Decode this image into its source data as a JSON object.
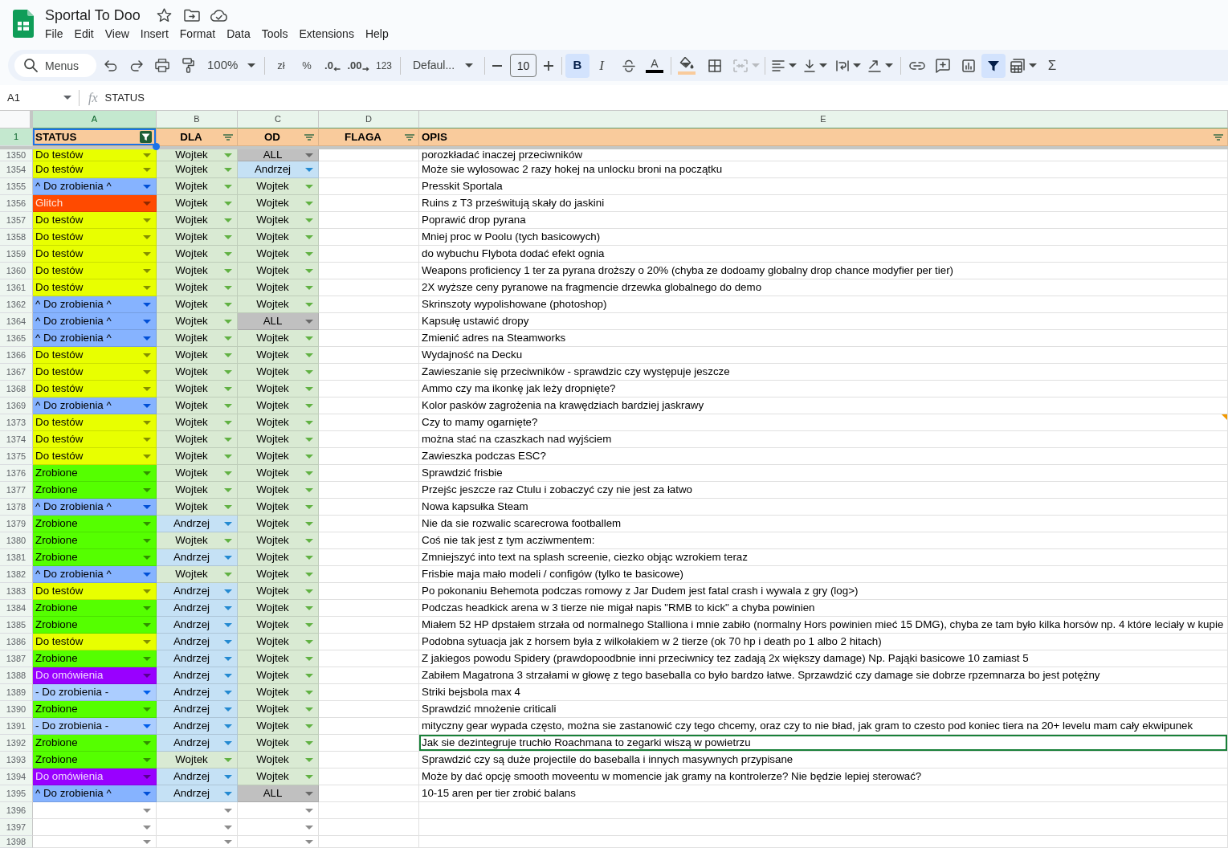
{
  "document": {
    "title": "Sportal To Doo",
    "menu": [
      "File",
      "Edit",
      "View",
      "Insert",
      "Format",
      "Data",
      "Tools",
      "Extensions",
      "Help"
    ]
  },
  "toolbar": {
    "search": {
      "placeholder": "Menus"
    },
    "zoom": "100%",
    "currency": "zł",
    "percent": "%",
    "decimal_decrease": ".0",
    "decimal_increase": ".00",
    "number_format": "123",
    "font": "Defaul...",
    "font_size": "10",
    "bold": {
      "label": "B",
      "selected": true
    },
    "italic": {
      "label": "I",
      "selected": false
    },
    "text_color": {
      "label": "A",
      "color": "#000000"
    },
    "fill_color": {
      "color": "#f9cb9c"
    },
    "merge": {
      "disabled": true
    },
    "filter": {
      "selected": true
    },
    "functions": "Σ"
  },
  "formula_bar": {
    "name_box": "A1",
    "fx": "fx",
    "content": "STATUS"
  },
  "sheet": {
    "column_letters": [
      {
        "label": "A",
        "selected": true
      },
      {
        "label": "B",
        "selected": false
      },
      {
        "label": "C",
        "selected": false
      },
      {
        "label": "D",
        "selected": false
      },
      {
        "label": "E",
        "selected": false
      }
    ],
    "header_row": {
      "number": "1",
      "cells": [
        {
          "text": "STATUS",
          "selected": true,
          "filter_active": true
        },
        {
          "text": "DLA",
          "selected": false,
          "filter_active": false
        },
        {
          "text": "OD",
          "selected": false,
          "filter_active": false
        },
        {
          "text": "FLAGA",
          "selected": false,
          "filter_active": false
        },
        {
          "text": "OPIS",
          "selected": false,
          "filter_active": false
        }
      ]
    },
    "rows": [
      {
        "number": "1350",
        "status": {
          "text": "Do testów",
          "color": "#e8ff00"
        },
        "dla": {
          "text": "Wojtek",
          "color": "#d9ead3"
        },
        "od": {
          "text": "ALL",
          "color": "#c0c0c0"
        },
        "opis": "porozkładać inaczej przeciwników",
        "note": false,
        "outlined": false
      },
      {
        "number": "1354",
        "status": {
          "text": "Do testów",
          "color": "#e8ff00"
        },
        "dla": {
          "text": "Wojtek",
          "color": "#d9ead3"
        },
        "od": {
          "text": "Andrzej",
          "color": "#c5e1f5"
        },
        "opis": "Może sie wylosowac 2 razy hokej na unlocku broni na początku",
        "note": false,
        "outlined": false
      },
      {
        "number": "1355",
        "status": {
          "text": "^ Do zrobienia ^",
          "color": "#86b3ff"
        },
        "dla": {
          "text": "Wojtek",
          "color": "#d9ead3"
        },
        "od": {
          "text": "Wojtek",
          "color": "#d9ead3"
        },
        "opis": "Presskit Sportala",
        "note": false,
        "outlined": false
      },
      {
        "number": "1356",
        "status": {
          "text": "Glitch",
          "color": "#ff4a00"
        },
        "dla": {
          "text": "Wojtek",
          "color": "#d9ead3"
        },
        "od": {
          "text": "Wojtek",
          "color": "#d9ead3"
        },
        "opis": "Ruins z T3 prześwitują skały do jaskini",
        "note": false,
        "outlined": false
      },
      {
        "number": "1357",
        "status": {
          "text": "Do testów",
          "color": "#e8ff00"
        },
        "dla": {
          "text": "Wojtek",
          "color": "#d9ead3"
        },
        "od": {
          "text": "Wojtek",
          "color": "#d9ead3"
        },
        "opis": "Poprawić drop pyrana",
        "note": false,
        "outlined": false
      },
      {
        "number": "1358",
        "status": {
          "text": "Do testów",
          "color": "#e8ff00"
        },
        "dla": {
          "text": "Wojtek",
          "color": "#d9ead3"
        },
        "od": {
          "text": "Wojtek",
          "color": "#d9ead3"
        },
        "opis": "Mniej proc w Poolu (tych basicowych)",
        "note": false,
        "outlined": false
      },
      {
        "number": "1359",
        "status": {
          "text": "Do testów",
          "color": "#e8ff00"
        },
        "dla": {
          "text": "Wojtek",
          "color": "#d9ead3"
        },
        "od": {
          "text": "Wojtek",
          "color": "#d9ead3"
        },
        "opis": "do wybuchu Flybota dodać efekt ognia",
        "note": false,
        "outlined": false
      },
      {
        "number": "1360",
        "status": {
          "text": "Do testów",
          "color": "#e8ff00"
        },
        "dla": {
          "text": "Wojtek",
          "color": "#d9ead3"
        },
        "od": {
          "text": "Wojtek",
          "color": "#d9ead3"
        },
        "opis": "Weapons proficiency 1 ter za pyrana droższy o 20% (chyba ze dodoamy globalny drop chance modyfier per tier)",
        "note": false,
        "outlined": false
      },
      {
        "number": "1361",
        "status": {
          "text": "Do testów",
          "color": "#e8ff00"
        },
        "dla": {
          "text": "Wojtek",
          "color": "#d9ead3"
        },
        "od": {
          "text": "Wojtek",
          "color": "#d9ead3"
        },
        "opis": "2X wyższe ceny pyranowe na fragmencie drzewka globalnego do demo",
        "note": false,
        "outlined": false
      },
      {
        "number": "1362",
        "status": {
          "text": "^ Do zrobienia ^",
          "color": "#86b3ff"
        },
        "dla": {
          "text": "Wojtek",
          "color": "#d9ead3"
        },
        "od": {
          "text": "Wojtek",
          "color": "#d9ead3"
        },
        "opis": "Skrinszoty wypolishowane (photoshop)",
        "note": false,
        "outlined": false
      },
      {
        "number": "1364",
        "status": {
          "text": "^ Do zrobienia ^",
          "color": "#86b3ff"
        },
        "dla": {
          "text": "Wojtek",
          "color": "#d9ead3"
        },
        "od": {
          "text": "ALL",
          "color": "#c0c0c0"
        },
        "opis": "Kapsułę ustawić dropy",
        "note": false,
        "outlined": false
      },
      {
        "number": "1365",
        "status": {
          "text": "^ Do zrobienia ^",
          "color": "#86b3ff"
        },
        "dla": {
          "text": "Wojtek",
          "color": "#d9ead3"
        },
        "od": {
          "text": "Wojtek",
          "color": "#d9ead3"
        },
        "opis": "Zmienić adres na Steamworks",
        "note": false,
        "outlined": false
      },
      {
        "number": "1366",
        "status": {
          "text": "Do testów",
          "color": "#e8ff00"
        },
        "dla": {
          "text": "Wojtek",
          "color": "#d9ead3"
        },
        "od": {
          "text": "Wojtek",
          "color": "#d9ead3"
        },
        "opis": "Wydajność na Decku",
        "note": false,
        "outlined": false
      },
      {
        "number": "1367",
        "status": {
          "text": "Do testów",
          "color": "#e8ff00"
        },
        "dla": {
          "text": "Wojtek",
          "color": "#d9ead3"
        },
        "od": {
          "text": "Wojtek",
          "color": "#d9ead3"
        },
        "opis": "Zawieszanie się przeciwników - sprawdzic czy występuje jeszcze",
        "note": false,
        "outlined": false
      },
      {
        "number": "1368",
        "status": {
          "text": "Do testów",
          "color": "#e8ff00"
        },
        "dla": {
          "text": "Wojtek",
          "color": "#d9ead3"
        },
        "od": {
          "text": "Wojtek",
          "color": "#d9ead3"
        },
        "opis": "Ammo czy ma ikonkę jak leży dropnięte?",
        "note": false,
        "outlined": false
      },
      {
        "number": "1369",
        "status": {
          "text": "^ Do zrobienia ^",
          "color": "#86b3ff"
        },
        "dla": {
          "text": "Wojtek",
          "color": "#d9ead3"
        },
        "od": {
          "text": "Wojtek",
          "color": "#d9ead3"
        },
        "opis": "Kolor pasków zagrożenia na krawędziach bardziej jaskrawy",
        "note": false,
        "outlined": false
      },
      {
        "number": "1373",
        "status": {
          "text": "Do testów",
          "color": "#e8ff00"
        },
        "dla": {
          "text": "Wojtek",
          "color": "#d9ead3"
        },
        "od": {
          "text": "Wojtek",
          "color": "#d9ead3"
        },
        "opis": "Czy to mamy ogarnięte?",
        "note": true,
        "outlined": false
      },
      {
        "number": "1374",
        "status": {
          "text": "Do testów",
          "color": "#e8ff00"
        },
        "dla": {
          "text": "Wojtek",
          "color": "#d9ead3"
        },
        "od": {
          "text": "Wojtek",
          "color": "#d9ead3"
        },
        "opis": "można stać na czaszkach nad wyjściem",
        "note": false,
        "outlined": false
      },
      {
        "number": "1375",
        "status": {
          "text": "Do testów",
          "color": "#e8ff00"
        },
        "dla": {
          "text": "Wojtek",
          "color": "#d9ead3"
        },
        "od": {
          "text": "Wojtek",
          "color": "#d9ead3"
        },
        "opis": "Zawieszka podczas ESC?",
        "note": false,
        "outlined": false
      },
      {
        "number": "1376",
        "status": {
          "text": "Zrobione",
          "color": "#55ff00"
        },
        "dla": {
          "text": "Wojtek",
          "color": "#d9ead3"
        },
        "od": {
          "text": "Wojtek",
          "color": "#d9ead3"
        },
        "opis": "Sprawdzić frisbie",
        "note": false,
        "outlined": false
      },
      {
        "number": "1377",
        "status": {
          "text": "Zrobione",
          "color": "#55ff00"
        },
        "dla": {
          "text": "Wojtek",
          "color": "#d9ead3"
        },
        "od": {
          "text": "Wojtek",
          "color": "#d9ead3"
        },
        "opis": "Przejśc jeszcze raz Ctulu i zobaczyć czy nie jest za łatwo",
        "note": false,
        "outlined": false
      },
      {
        "number": "1378",
        "status": {
          "text": "^ Do zrobienia ^",
          "color": "#86b3ff"
        },
        "dla": {
          "text": "Wojtek",
          "color": "#d9ead3"
        },
        "od": {
          "text": "Wojtek",
          "color": "#d9ead3"
        },
        "opis": "Nowa kapsułka Steam",
        "note": false,
        "outlined": false
      },
      {
        "number": "1379",
        "status": {
          "text": "Zrobione",
          "color": "#55ff00"
        },
        "dla": {
          "text": "Andrzej",
          "color": "#c5e1f5"
        },
        "od": {
          "text": "Wojtek",
          "color": "#d9ead3"
        },
        "opis": "Nie da sie rozwalic scarecrowa footballem",
        "note": false,
        "outlined": false
      },
      {
        "number": "1380",
        "status": {
          "text": "Zrobione",
          "color": "#55ff00"
        },
        "dla": {
          "text": "Wojtek",
          "color": "#d9ead3"
        },
        "od": {
          "text": "Wojtek",
          "color": "#d9ead3"
        },
        "opis": "Coś nie tak jest z tym acziwmentem:",
        "note": false,
        "outlined": false
      },
      {
        "number": "1381",
        "status": {
          "text": "Zrobione",
          "color": "#55ff00"
        },
        "dla": {
          "text": "Andrzej",
          "color": "#c5e1f5"
        },
        "od": {
          "text": "Wojtek",
          "color": "#d9ead3"
        },
        "opis": "Zmniejszyć into text na splash screenie, ciezko objąc wzrokiem teraz",
        "note": false,
        "outlined": false
      },
      {
        "number": "1382",
        "status": {
          "text": "^ Do zrobienia ^",
          "color": "#86b3ff"
        },
        "dla": {
          "text": "Wojtek",
          "color": "#d9ead3"
        },
        "od": {
          "text": "Wojtek",
          "color": "#d9ead3"
        },
        "opis": "Frisbie maja mało modeli / configów (tylko te basicowe)",
        "note": false,
        "outlined": false
      },
      {
        "number": "1383",
        "status": {
          "text": "Do testów",
          "color": "#e8ff00"
        },
        "dla": {
          "text": "Andrzej",
          "color": "#c5e1f5"
        },
        "od": {
          "text": "Wojtek",
          "color": "#d9ead3"
        },
        "opis": "Po pokonaniu Behemota podczas romowy z Jar Dudem jest fatal crash i wywala z gry (log>)",
        "note": false,
        "outlined": false
      },
      {
        "number": "1384",
        "status": {
          "text": "Zrobione",
          "color": "#55ff00"
        },
        "dla": {
          "text": "Andrzej",
          "color": "#c5e1f5"
        },
        "od": {
          "text": "Wojtek",
          "color": "#d9ead3"
        },
        "opis": "Podczas headkick arena w 3 tierze nie migał napis \"RMB to kick\" a chyba powinien",
        "note": false,
        "outlined": false
      },
      {
        "number": "1385",
        "status": {
          "text": "Zrobione",
          "color": "#55ff00"
        },
        "dla": {
          "text": "Andrzej",
          "color": "#c5e1f5"
        },
        "od": {
          "text": "Wojtek",
          "color": "#d9ead3"
        },
        "opis": "Miałem 52 HP dpstałem strzała od normalnego Stalliona i mnie zabiło (normalny Hors powinien mieć 15 DMG), chyba ze tam było kilka horsów np. 4 które leciały w kupie",
        "note": false,
        "outlined": false
      },
      {
        "number": "1386",
        "status": {
          "text": "Do testów",
          "color": "#e8ff00"
        },
        "dla": {
          "text": "Andrzej",
          "color": "#c5e1f5"
        },
        "od": {
          "text": "Wojtek",
          "color": "#d9ead3"
        },
        "opis": "Podobna sytuacja jak z horsem była z wilkołakiem w 2 tierze (ok 70 hp i death po 1 albo 2 hitach)",
        "note": false,
        "outlined": false
      },
      {
        "number": "1387",
        "status": {
          "text": "Zrobione",
          "color": "#55ff00"
        },
        "dla": {
          "text": "Andrzej",
          "color": "#c5e1f5"
        },
        "od": {
          "text": "Wojtek",
          "color": "#d9ead3"
        },
        "opis": "Z jakiegos powodu Spidery (prawdopoodbnie inni przeciwnicy tez zadają 2x większy damage) Np. Pająki basicowe 10 zamiast 5",
        "note": false,
        "outlined": false
      },
      {
        "number": "1388",
        "status": {
          "text": "Do omówienia",
          "color": "#9900ff"
        },
        "dla": {
          "text": "Andrzej",
          "color": "#c5e1f5"
        },
        "od": {
          "text": "Wojtek",
          "color": "#d9ead3"
        },
        "opis": "Zabiłem Magatrona 3 strzałami w głowę z tego baseballa co było bardzo łatwe. Sprzawdzić czy damage sie dobrze rpzemnarza bo jest potężny",
        "note": false,
        "outlined": false
      },
      {
        "number": "1389",
        "status": {
          "text": "- Do zrobienia -",
          "color": "#abcdff"
        },
        "dla": {
          "text": "Andrzej",
          "color": "#c5e1f5"
        },
        "od": {
          "text": "Wojtek",
          "color": "#d9ead3"
        },
        "opis": "Striki bejsbola max 4",
        "note": false,
        "outlined": false
      },
      {
        "number": "1390",
        "status": {
          "text": "Zrobione",
          "color": "#55ff00"
        },
        "dla": {
          "text": "Andrzej",
          "color": "#c5e1f5"
        },
        "od": {
          "text": "Wojtek",
          "color": "#d9ead3"
        },
        "opis": "Sprawdzić mnożenie criticali",
        "note": false,
        "outlined": false
      },
      {
        "number": "1391",
        "status": {
          "text": "- Do zrobienia -",
          "color": "#abcdff"
        },
        "dla": {
          "text": "Andrzej",
          "color": "#c5e1f5"
        },
        "od": {
          "text": "Wojtek",
          "color": "#d9ead3"
        },
        "opis": "mityczny gear wypada często, można sie zastanowić czy tego chcemy, oraz czy to nie bład, jak gram to czesto pod koniec tiera na 20+ levelu mam cały ekwipunek",
        "note": false,
        "outlined": false
      },
      {
        "number": "1392",
        "status": {
          "text": "Zrobione",
          "color": "#55ff00"
        },
        "dla": {
          "text": "Andrzej",
          "color": "#c5e1f5"
        },
        "od": {
          "text": "Wojtek",
          "color": "#d9ead3"
        },
        "opis": "Jak sie dezintegruje truchło Roachmana to zegarki wiszą w powietrzu",
        "note": false,
        "outlined": true
      },
      {
        "number": "1393",
        "status": {
          "text": "Zrobione",
          "color": "#55ff00"
        },
        "dla": {
          "text": "Wojtek",
          "color": "#d9ead3"
        },
        "od": {
          "text": "Wojtek",
          "color": "#d9ead3"
        },
        "opis": "Sprawdzić czy są duże projectile do baseballa i innych masywnych przypisane",
        "note": false,
        "outlined": false
      },
      {
        "number": "1394",
        "status": {
          "text": "Do omówienia",
          "color": "#9900ff"
        },
        "dla": {
          "text": "Andrzej",
          "color": "#c5e1f5"
        },
        "od": {
          "text": "Wojtek",
          "color": "#d9ead3"
        },
        "opis": "Może by dać opcję smooth moveentu w momencie jak gramy na kontrolerze? Nie będzie lepiej sterować?",
        "note": false,
        "outlined": false
      },
      {
        "number": "1395",
        "status": {
          "text": "^ Do zrobienia ^",
          "color": "#86b3ff"
        },
        "dla": {
          "text": "Andrzej",
          "color": "#c5e1f5"
        },
        "od": {
          "text": "ALL",
          "color": "#c0c0c0"
        },
        "opis": "10-15 aren per tier zrobić balans",
        "note": false,
        "outlined": false
      },
      {
        "number": "1396",
        "note": false,
        "outlined": false
      },
      {
        "number": "1397",
        "note": false,
        "outlined": false
      },
      {
        "number": "1398",
        "note": false,
        "outlined": false
      }
    ]
  }
}
